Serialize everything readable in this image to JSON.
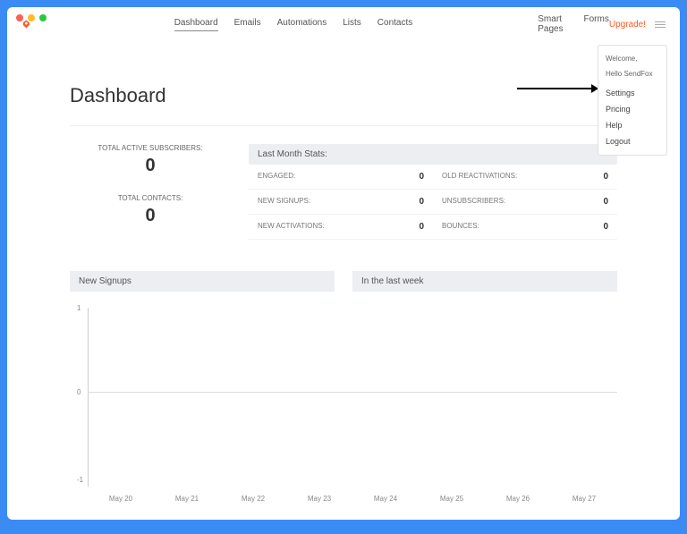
{
  "nav": {
    "items": [
      "Dashboard",
      "Emails",
      "Automations",
      "Lists",
      "Contacts"
    ],
    "right": [
      "Smart Pages",
      "Forms"
    ],
    "upgrade": "Upgrade!"
  },
  "dropdown": {
    "welcome": "Welcome,",
    "hello": "Hello SendFox",
    "items": [
      "Settings",
      "Pricing",
      "Help",
      "Logout"
    ]
  },
  "page_title": "Dashboard",
  "left_stats": [
    {
      "label": "TOTAL ACTIVE SUBSCRIBERS:",
      "value": "0"
    },
    {
      "label": "TOTAL CONTACTS:",
      "value": "0"
    }
  ],
  "last_month": {
    "header": "Last Month Stats:",
    "col1": [
      {
        "k": "ENGAGED:",
        "v": "0"
      },
      {
        "k": "NEW SIGNUPS:",
        "v": "0"
      },
      {
        "k": "NEW ACTIVATIONS:",
        "v": "0"
      }
    ],
    "col2": [
      {
        "k": "OLD REACTIVATIONS:",
        "v": "0"
      },
      {
        "k": "UNSUBSCRIBERS:",
        "v": "0"
      },
      {
        "k": "BOUNCES:",
        "v": "0"
      }
    ]
  },
  "chart": {
    "header1": "New Signups",
    "header2": "In the last week"
  },
  "chart_data": {
    "type": "line",
    "categories": [
      "May 20",
      "May 21",
      "May 22",
      "May 23",
      "May 24",
      "May 25",
      "May 26",
      "May 27"
    ],
    "values": [
      0,
      0,
      0,
      0,
      0,
      0,
      0,
      0
    ],
    "title": "New Signups",
    "xlabel": "",
    "ylabel": "",
    "ylim": [
      -1,
      1
    ],
    "yticks": [
      1,
      0,
      -1
    ]
  }
}
